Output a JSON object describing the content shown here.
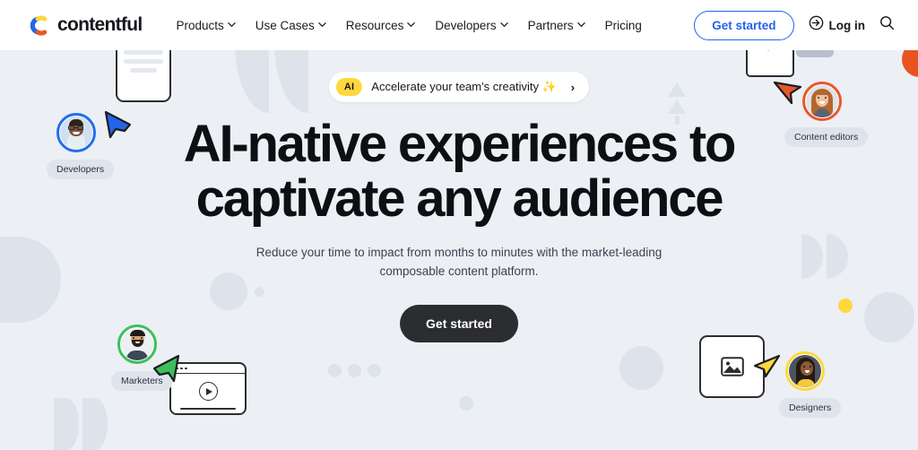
{
  "brand": {
    "name": "contentful",
    "logo_colors": {
      "blue": "#2463eb",
      "yellow": "#ffd83d",
      "orange": "#e8572a"
    }
  },
  "header": {
    "nav_items": [
      {
        "label": "Products",
        "has_dropdown": true
      },
      {
        "label": "Use Cases",
        "has_dropdown": true
      },
      {
        "label": "Resources",
        "has_dropdown": true
      },
      {
        "label": "Developers",
        "has_dropdown": true
      },
      {
        "label": "Partners",
        "has_dropdown": true
      },
      {
        "label": "Pricing",
        "has_dropdown": false
      }
    ],
    "get_started_label": "Get started",
    "login_label": "Log in",
    "login_icon": "sign-in-icon",
    "search_icon": "search-icon",
    "get_started_color": "#2463eb"
  },
  "hero": {
    "announcement": {
      "badge": "AI",
      "text": "Accelerate your team's creativity ✨",
      "arrow": "›",
      "badge_color": "#ffd83d"
    },
    "headline_line1": "AI-native experiences to",
    "headline_line2": "captivate any audience",
    "subheadline": "Reduce your time to impact from months to minutes with the market-leading composable content platform.",
    "cta_label": "Get started",
    "cta_bg": "#2b2d31"
  },
  "personas": [
    {
      "label": "Developers",
      "ring_color": "#1f6feb",
      "cursor_color": "#2463eb"
    },
    {
      "label": "Content editors",
      "ring_color": "#e8572a",
      "cursor_color": "#e8572a"
    },
    {
      "label": "Marketers",
      "ring_color": "#3bbf5c",
      "cursor_color": "#3bbf5c"
    },
    {
      "label": "Designers",
      "ring_color": "#ffd83d",
      "cursor_color": "#ffd83d"
    }
  ],
  "decorations": {
    "document_card": "article-card",
    "letter_card": "letter-a-card",
    "video_card": "video-player-card",
    "image_card": "image-placeholder-card",
    "letter_glyph": "a",
    "accent_dot_color": "#ffd83d",
    "shape_color": "#dde3ea",
    "background_color": "#eceff4"
  }
}
